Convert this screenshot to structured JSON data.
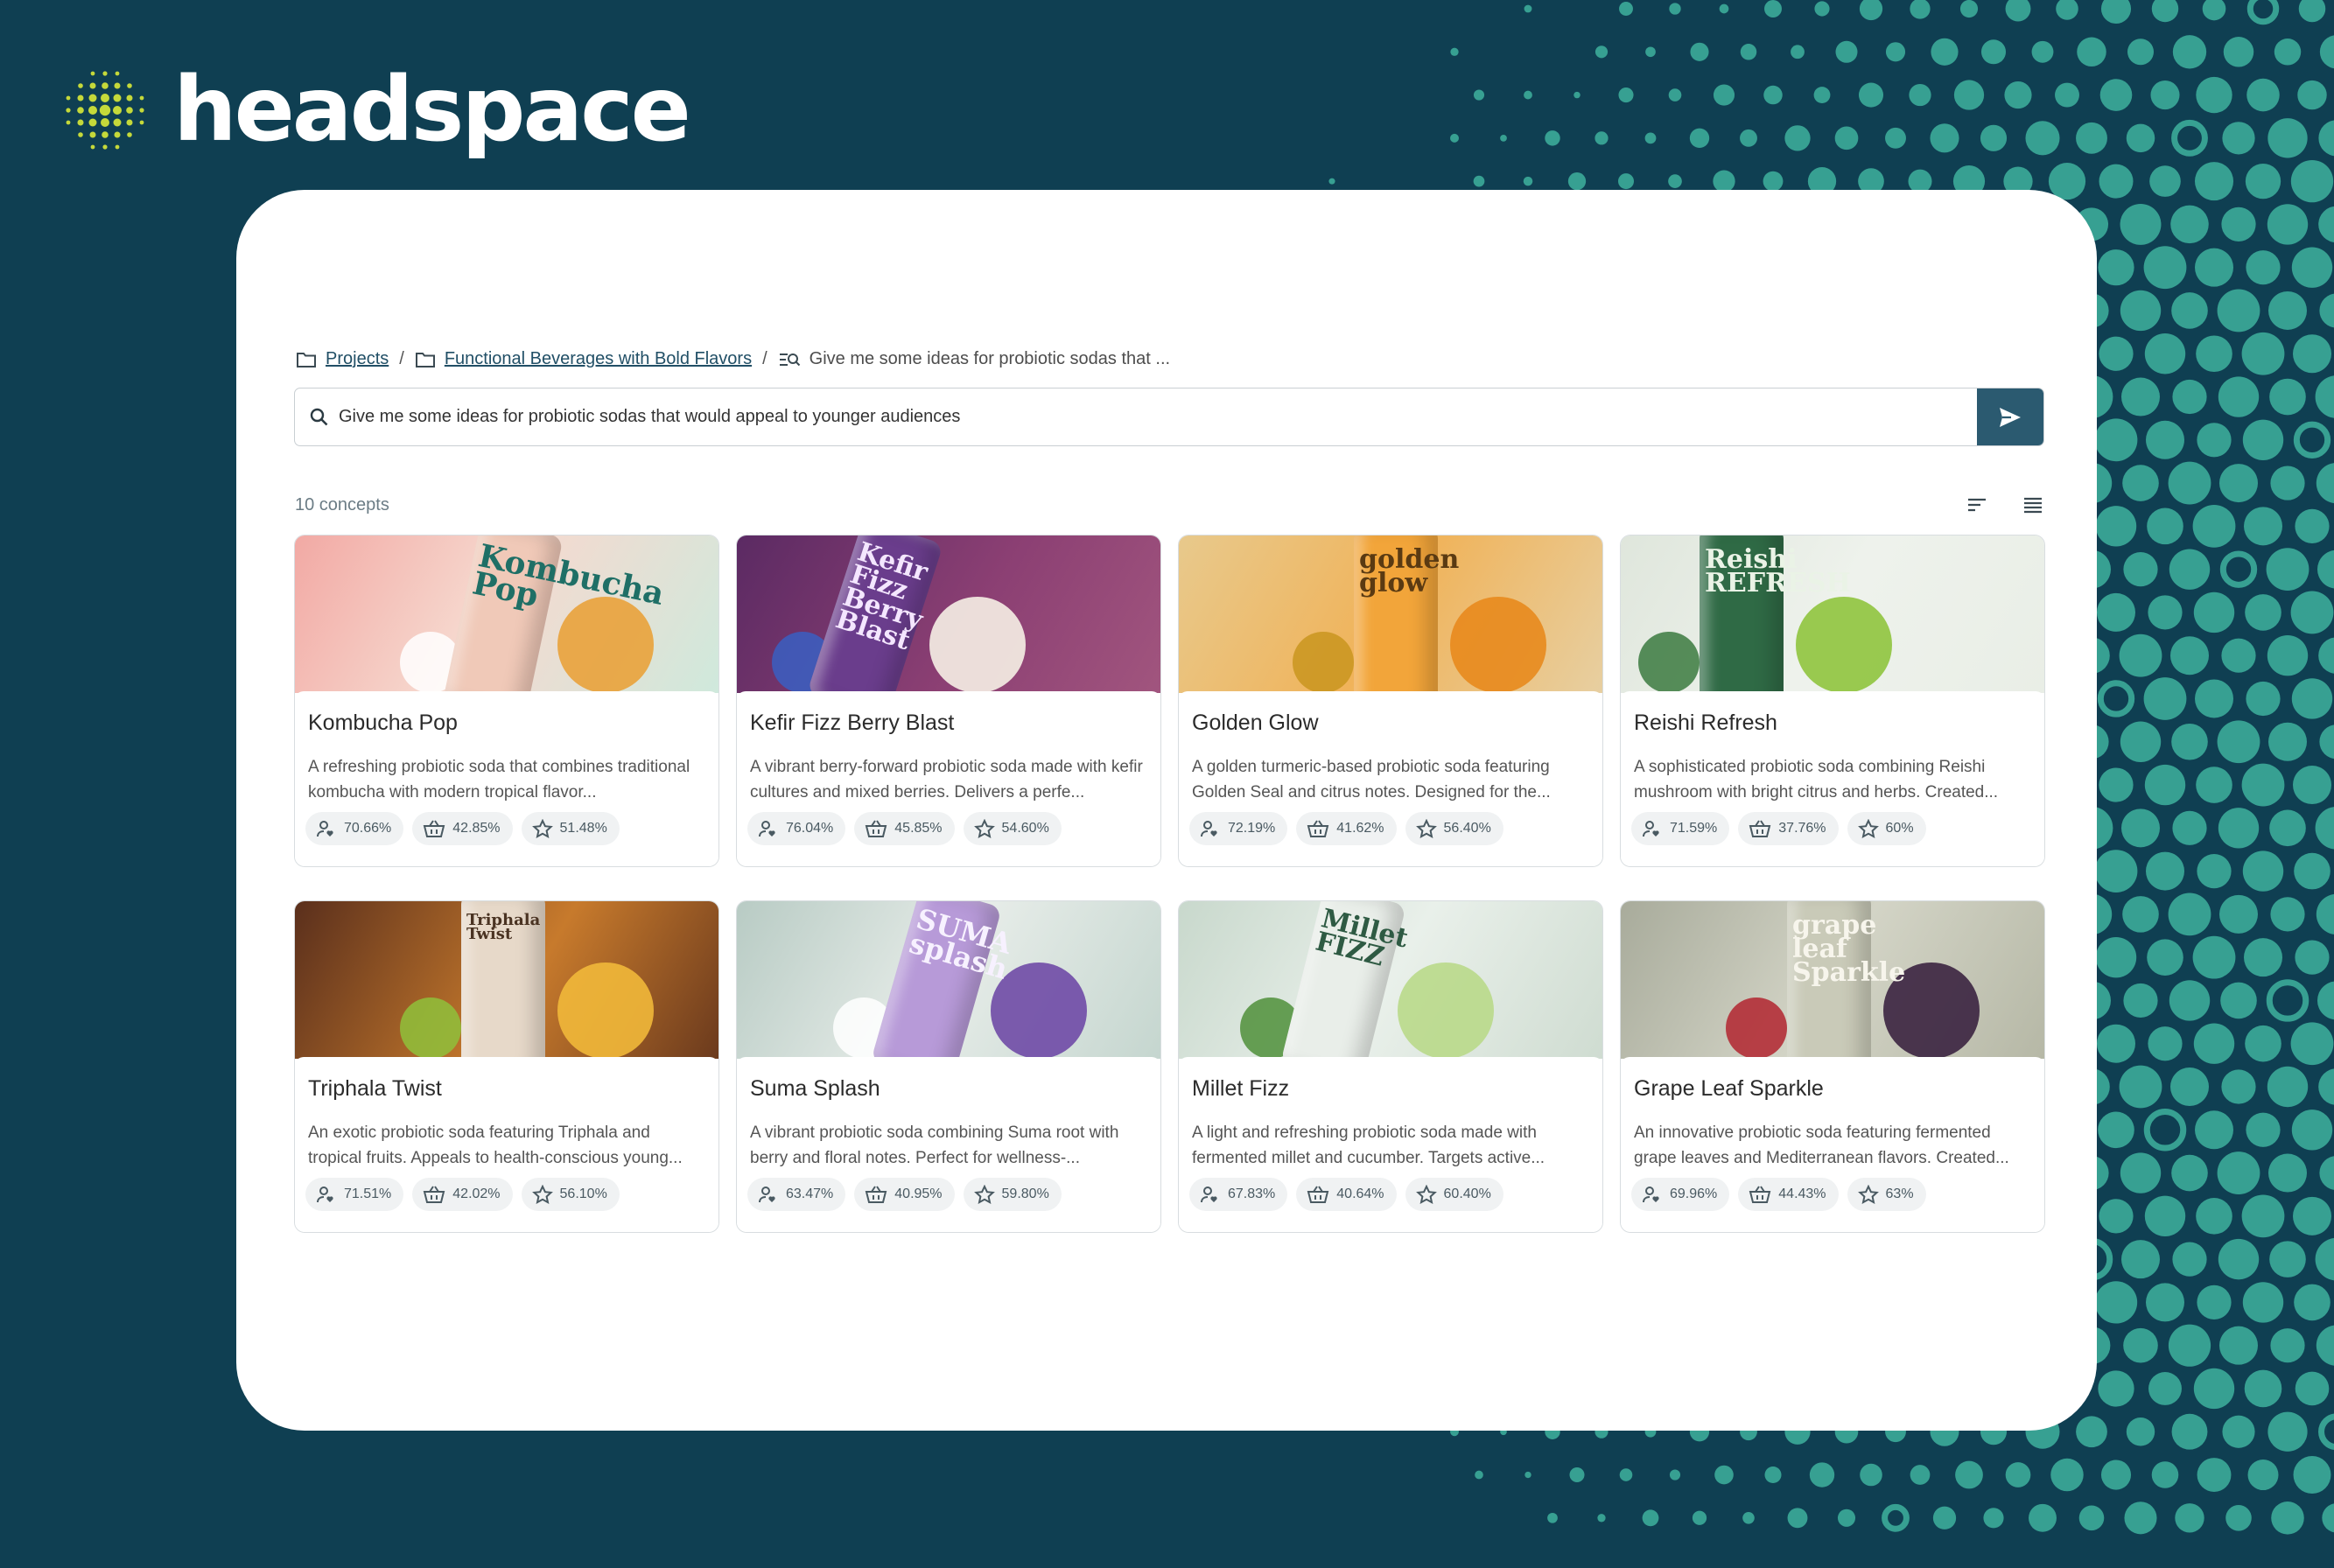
{
  "brand": {
    "name": "headspace",
    "accent": "#c5d93a"
  },
  "breadcrumb": {
    "items": [
      {
        "label": "Projects"
      },
      {
        "label": "Functional Beverages with Bold Flavors"
      },
      {
        "label": "Give me some ideas for probiotic sodas that ..."
      }
    ]
  },
  "search": {
    "value": "Give me some ideas for probiotic sodas that would appeal to younger audiences"
  },
  "results": {
    "count_label": "10 concepts"
  },
  "colors": {
    "background": "#0f3f52",
    "dots": "#3aa596",
    "send_button": "#2b5a70",
    "panel": "#ffffff"
  },
  "concepts": [
    {
      "title": "Kombucha Pop",
      "description": "A refreshing probiotic soda that combines traditional kombucha with modern tropical flavor...",
      "metrics": [
        "70.66%",
        "42.85%",
        "51.48%"
      ],
      "image_text": [
        "Kombucha",
        "Pop"
      ]
    },
    {
      "title": "Kefir Fizz Berry Blast",
      "description": "A vibrant berry-forward probiotic soda made with kefir cultures and mixed berries. Delivers a perfe...",
      "metrics": [
        "76.04%",
        "45.85%",
        "54.60%"
      ],
      "image_text": [
        "Kefir",
        "Fizz",
        "Berry",
        "Blast"
      ]
    },
    {
      "title": "Golden Glow",
      "description": "A golden turmeric-based probiotic soda featuring Golden Seal and citrus notes. Designed for the...",
      "metrics": [
        "72.19%",
        "41.62%",
        "56.40%"
      ],
      "image_text": [
        "golden",
        "glow"
      ]
    },
    {
      "title": "Reishi Refresh",
      "description": "A sophisticated probiotic soda combining Reishi mushroom with bright citrus and herbs. Created...",
      "metrics": [
        "71.59%",
        "37.76%",
        "60%"
      ],
      "image_text": [
        "Reishi",
        "REFRESH"
      ]
    },
    {
      "title": "Triphala Twist",
      "description": "An exotic probiotic soda featuring Triphala and tropical fruits. Appeals to health-conscious young...",
      "metrics": [
        "71.51%",
        "42.02%",
        "56.10%"
      ],
      "image_text": [
        "Triphala",
        "Twist"
      ]
    },
    {
      "title": "Suma Splash",
      "description": "A vibrant probiotic soda combining Suma root with berry and floral notes. Perfect for wellness-...",
      "metrics": [
        "63.47%",
        "40.95%",
        "59.80%"
      ],
      "image_text": [
        "SUMA",
        "splash"
      ]
    },
    {
      "title": "Millet Fizz",
      "description": "A light and refreshing probiotic soda made with fermented millet and cucumber. Targets active...",
      "metrics": [
        "67.83%",
        "40.64%",
        "60.40%"
      ],
      "image_text": [
        "Millet",
        "FIZZ"
      ]
    },
    {
      "title": "Grape Leaf Sparkle",
      "description": "An innovative probiotic soda featuring fermented grape leaves and Mediterranean flavors. Created...",
      "metrics": [
        "69.96%",
        "44.43%",
        "63%"
      ],
      "image_text": [
        "grape",
        "leaf",
        "Sparkle"
      ]
    }
  ],
  "metric_icons": [
    "user-heart-icon",
    "basket-icon",
    "star-icon"
  ]
}
